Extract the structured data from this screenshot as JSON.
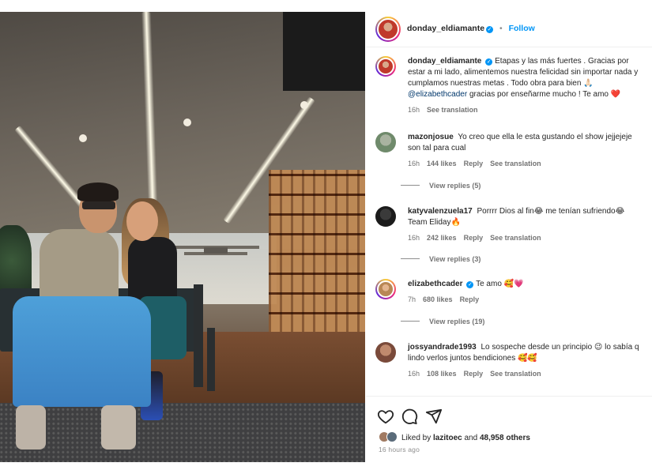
{
  "header": {
    "username": "donday_eldiamante",
    "follow_label": "Follow",
    "separator": "•"
  },
  "caption": {
    "username": "donday_eldiamante",
    "text": "Etapas y las más fuertes . Gracias por estar a mi lado, alimentemos nuestra felicidad sin importar nada y cumplamos nuestras metas . Todo obra para bien 🙏🏻",
    "mention": "@elizabethcader",
    "text2": " gracias por enseñarme mucho ! Te amo ❤️",
    "time": "16h",
    "see_translation": "See translation"
  },
  "comments": [
    {
      "username": "mazonjosue",
      "text": "Yo creo que ella le esta gustando el show jejjejeje son tal para cual",
      "time": "16h",
      "likes": "144 likes",
      "reply": "Reply",
      "see_translation": "See translation",
      "view_replies": "View replies (5)"
    },
    {
      "username": "katyvalenzuela17",
      "text": "Porrrr Dios al fin😂 me tenían sufriendo😂 Team Eliday🔥",
      "time": "16h",
      "likes": "242 likes",
      "reply": "Reply",
      "see_translation": "See translation",
      "view_replies": "View replies (3)"
    },
    {
      "username": "elizabethcader",
      "text": "Te amo 🥰💗",
      "time": "7h",
      "likes": "680 likes",
      "reply": "Reply",
      "view_replies": "View replies (19)"
    },
    {
      "username": "jossyandrade1993",
      "text": "Lo sospeche desde un principio 😉 lo sabía q lindo verlos juntos bendiciones 🥰🥰",
      "time": "16h",
      "likes": "108 likes",
      "reply": "Reply",
      "see_translation": "See translation"
    }
  ],
  "actions": {
    "liked_by_prefix": "Liked by ",
    "liked_by_user": "lazitoec",
    "and": " and ",
    "others": "48,958 others",
    "time_ago": "16 hours ago"
  },
  "icons": {
    "heart": "heart-icon",
    "comment": "comment-icon",
    "share": "share-icon"
  },
  "colors": {
    "link_blue": "#0095f6",
    "mention_blue": "#00376b",
    "muted": "#737373"
  }
}
